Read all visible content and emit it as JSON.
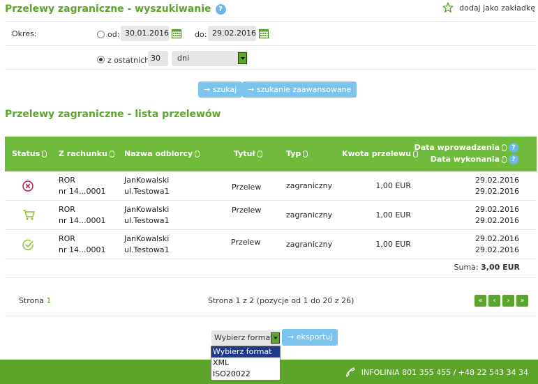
{
  "header": {
    "title": "Przelewy zagraniczne - wyszukiwanie",
    "help": "?",
    "bookmark_label": "dodaj jako zakładkę"
  },
  "filter": {
    "okres_label": "Okres:",
    "od_label": "od:",
    "od_value": "30.01.2016",
    "do_label": "do:",
    "do_value": "29.02.2016",
    "last_label": "z ostatnich",
    "last_value": "30",
    "unit_value": "dni",
    "search_button": "→ szukaj",
    "advanced_button": "→ szukanie zaawansowane"
  },
  "list": {
    "title": "Przelewy zagraniczne - lista przelewów",
    "columns": {
      "status": "Status",
      "account": "Z rachunku",
      "recipient": "Nazwa odbiorcy",
      "title": "Tytuł",
      "type": "Typ",
      "amount": "Kwota przelewu",
      "date_entered": "Data wprowadzenia",
      "date_executed": "Data wykonania"
    },
    "rows": [
      {
        "status_icon": "cancel-icon",
        "account_1": "ROR",
        "account_2": "nr 14...0001",
        "recipient_1": "JanKowalski",
        "recipient_2": "ul.Testowa1",
        "title": "Przelew",
        "type": "zagraniczny",
        "amount": "1,00 EUR",
        "date_1": "29.02.2016",
        "date_2": "29.02.2016"
      },
      {
        "status_icon": "cart-icon",
        "account_1": "ROR",
        "account_2": "nr 14...0001",
        "recipient_1": "JanKowalski",
        "recipient_2": "ul.Testowa1",
        "title": "Przelew",
        "type": "zagraniczny",
        "amount": "1,00 EUR",
        "date_1": "29.02.2016",
        "date_2": "29.02.2016"
      },
      {
        "status_icon": "check-circle-icon",
        "account_1": "ROR",
        "account_2": "nr 14...0001",
        "recipient_1": "JanKowalski",
        "recipient_2": "ul.Testowa1",
        "title": "Przelew",
        "type": "zagraniczny",
        "amount": "1,00 EUR",
        "date_1": "29.02.2016",
        "date_2": "29.02.2016"
      }
    ],
    "sum_label": "Suma:",
    "sum_value": "3,00 EUR"
  },
  "pager": {
    "page_label": "Strona",
    "page_number": "1",
    "info": "Strona 1 z 2 (pozycje od 1 do 20 z 26)",
    "first": "«",
    "prev": "‹",
    "next": "›",
    "last": "»"
  },
  "export": {
    "format_selected": "Wybierz format",
    "options": [
      "Wybierz format",
      "XML",
      "ISO20022"
    ],
    "export_button": "→ eksportuj"
  },
  "footer": {
    "infoline": "INFOLINIA 801 355 455 / +48 22 543 34 34"
  },
  "colors": {
    "brand_green": "#5aa52a",
    "header_green": "#6fbb3b",
    "button_blue": "#7cc4ec",
    "selected_option": "#1e3a8a"
  }
}
